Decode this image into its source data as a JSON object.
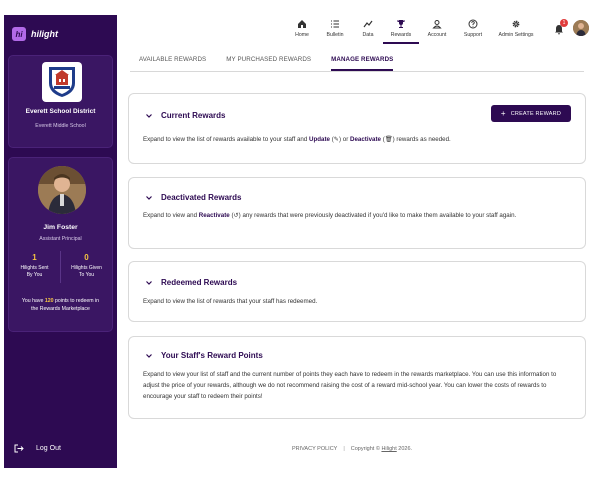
{
  "brand": {
    "logo_text": "hi",
    "name": "hilight"
  },
  "school": {
    "name": "Everett School District",
    "sub": "Everett Middle School"
  },
  "user": {
    "name": "Jim Foster",
    "role": "Assistant Principal",
    "stats": [
      {
        "value": "1",
        "label_line1": "Hilights Sent",
        "label_line2": "By You"
      },
      {
        "value": "0",
        "label_line1": "Hilights Given",
        "label_line2": "To You"
      }
    ],
    "points_prefix": "You have",
    "points_value": "120",
    "points_suffix_line1": "points to redeem in",
    "points_suffix_line2": "the Rewards Marketplace"
  },
  "logout_label": "Log Out",
  "nav": [
    {
      "label": "Home",
      "icon": "home-icon"
    },
    {
      "label": "Bulletin",
      "icon": "list-icon"
    },
    {
      "label": "Data",
      "icon": "chart-line-icon"
    },
    {
      "label": "Rewards",
      "icon": "trophy-icon",
      "active": true
    },
    {
      "label": "Account",
      "icon": "user-icon"
    },
    {
      "label": "Support",
      "icon": "help-icon"
    },
    {
      "label": "Admin Settings",
      "icon": "gear-icon"
    }
  ],
  "notifications_count": "1",
  "tabs": [
    {
      "label": "AVAILABLE REWARDS"
    },
    {
      "label": "MY PURCHASED REWARDS"
    },
    {
      "label": "MANAGE REWARDS",
      "active": true
    }
  ],
  "panels": {
    "current": {
      "title": "Current Rewards",
      "button": "CREATE REWARD",
      "desc_1": "Expand to view the list of rewards available to your staff and ",
      "update": "Update",
      "desc_2": " or ",
      "deactivate": "Deactivate",
      "desc_3": " rewards as needed."
    },
    "deactivated": {
      "title": "Deactivated Rewards",
      "desc_1": "Expand to view and ",
      "reactivate": "Reactivate",
      "desc_2": " any rewards that were previously deactivated if you'd like to make them available to your staff again."
    },
    "redeemed": {
      "title": "Redeemed Rewards",
      "desc": "Expand to view the list of rewards that your staff has redeemed."
    },
    "points": {
      "title": "Your Staff's Reward Points",
      "desc": "Expand to view your list of staff and the current number of points they each have to redeem in the rewards marketplace. You can use this information to adjust the price of your rewards, although we do not recommend raising the cost of a reward mid-school year. You can lower the costs of rewards to encourage your staff to redeem their points!"
    }
  },
  "footer": {
    "privacy": "PRIVACY POLICY",
    "copyright_prefix": "Copyright ©",
    "copyright_brand": "Hilight",
    "copyright_year": "2026."
  },
  "colors": {
    "brand_purple": "#2d0a52",
    "accent_gold": "#f5c542",
    "badge_red": "#e03b3b"
  }
}
